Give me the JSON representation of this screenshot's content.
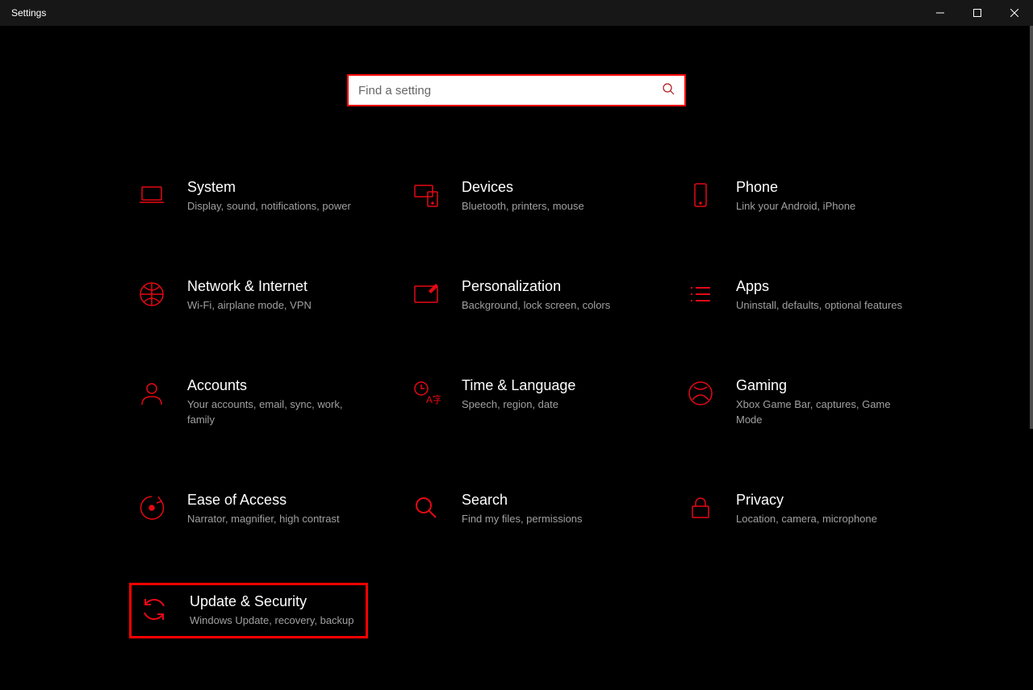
{
  "window": {
    "title": "Settings"
  },
  "search": {
    "placeholder": "Find a setting"
  },
  "tiles": [
    {
      "id": "system",
      "title": "System",
      "desc": "Display, sound, notifications, power"
    },
    {
      "id": "devices",
      "title": "Devices",
      "desc": "Bluetooth, printers, mouse"
    },
    {
      "id": "phone",
      "title": "Phone",
      "desc": "Link your Android, iPhone"
    },
    {
      "id": "network",
      "title": "Network & Internet",
      "desc": "Wi-Fi, airplane mode, VPN"
    },
    {
      "id": "personalization",
      "title": "Personalization",
      "desc": "Background, lock screen, colors"
    },
    {
      "id": "apps",
      "title": "Apps",
      "desc": "Uninstall, defaults, optional features"
    },
    {
      "id": "accounts",
      "title": "Accounts",
      "desc": "Your accounts, email, sync, work, family"
    },
    {
      "id": "time",
      "title": "Time & Language",
      "desc": "Speech, region, date"
    },
    {
      "id": "gaming",
      "title": "Gaming",
      "desc": "Xbox Game Bar, captures, Game Mode"
    },
    {
      "id": "ease",
      "title": "Ease of Access",
      "desc": "Narrator, magnifier, high contrast"
    },
    {
      "id": "search",
      "title": "Search",
      "desc": "Find my files, permissions"
    },
    {
      "id": "privacy",
      "title": "Privacy",
      "desc": "Location, camera, microphone"
    },
    {
      "id": "update",
      "title": "Update & Security",
      "desc": "Windows Update, recovery, backup"
    }
  ]
}
